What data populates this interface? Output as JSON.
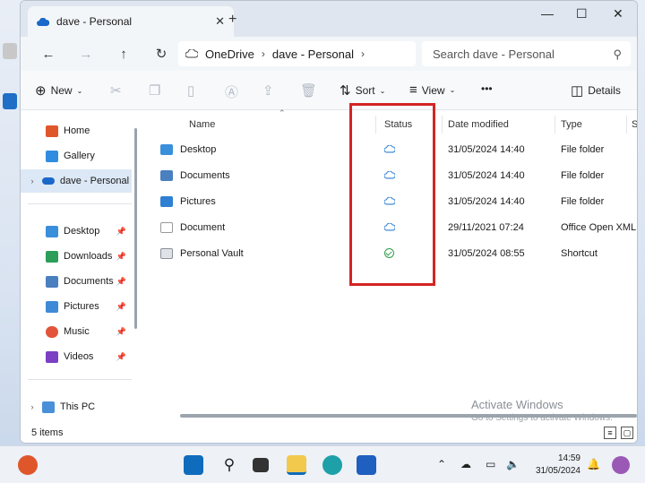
{
  "window": {
    "tab_title": "dave - Personal",
    "new_tab": "+",
    "minimize": "—",
    "maximize": "☐",
    "close": "✕",
    "tab_close": "✕"
  },
  "nav": {
    "back": "←",
    "forward": "→",
    "up": "↑",
    "refresh": "↻",
    "breadcrumb": [
      "OneDrive",
      "dave - Personal"
    ],
    "search_placeholder": "Search dave - Personal"
  },
  "toolbar": {
    "new_label": "New",
    "sort_label": "Sort",
    "view_label": "View",
    "more_label": "•••",
    "details_label": "Details"
  },
  "sidebar": {
    "items": [
      {
        "label": "Home",
        "icon": "home-icon"
      },
      {
        "label": "Gallery",
        "icon": "gallery-icon"
      },
      {
        "label": "dave - Personal",
        "icon": "onedrive-icon"
      },
      {
        "label": "Desktop",
        "icon": "desktop-icon"
      },
      {
        "label": "Downloads",
        "icon": "download-icon"
      },
      {
        "label": "Documents",
        "icon": "documents-icon"
      },
      {
        "label": "Pictures",
        "icon": "pictures-icon"
      },
      {
        "label": "Music",
        "icon": "music-icon"
      },
      {
        "label": "Videos",
        "icon": "videos-icon"
      },
      {
        "label": "This PC",
        "icon": "computer-icon"
      }
    ]
  },
  "columns": {
    "name": "Name",
    "status": "Status",
    "date": "Date modified",
    "type": "Type",
    "size": "S"
  },
  "files": [
    {
      "name": "Desktop",
      "status": "cloud",
      "date": "31/05/2024 14:40",
      "type": "File folder"
    },
    {
      "name": "Documents",
      "status": "cloud",
      "date": "31/05/2024 14:40",
      "type": "File folder"
    },
    {
      "name": "Pictures",
      "status": "cloud",
      "date": "31/05/2024 14:40",
      "type": "File folder"
    },
    {
      "name": "Document",
      "status": "cloud",
      "date": "29/11/2021 07:24",
      "type": "Office Open XML ..."
    },
    {
      "name": "Personal Vault",
      "status": "available",
      "date": "31/05/2024 08:55",
      "type": "Shortcut"
    }
  ],
  "statusbar": {
    "count": "5 items"
  },
  "watermark": {
    "line1": "Activate Windows",
    "line2": "Go to Settings to activate Windows."
  },
  "taskbar": {
    "time": "14:59",
    "date": "31/05/2024"
  },
  "colors": {
    "accent": "#0067c0",
    "highlight": "#d42424",
    "status_ok": "#2e9d47",
    "cloud": "#2f7fd3"
  }
}
